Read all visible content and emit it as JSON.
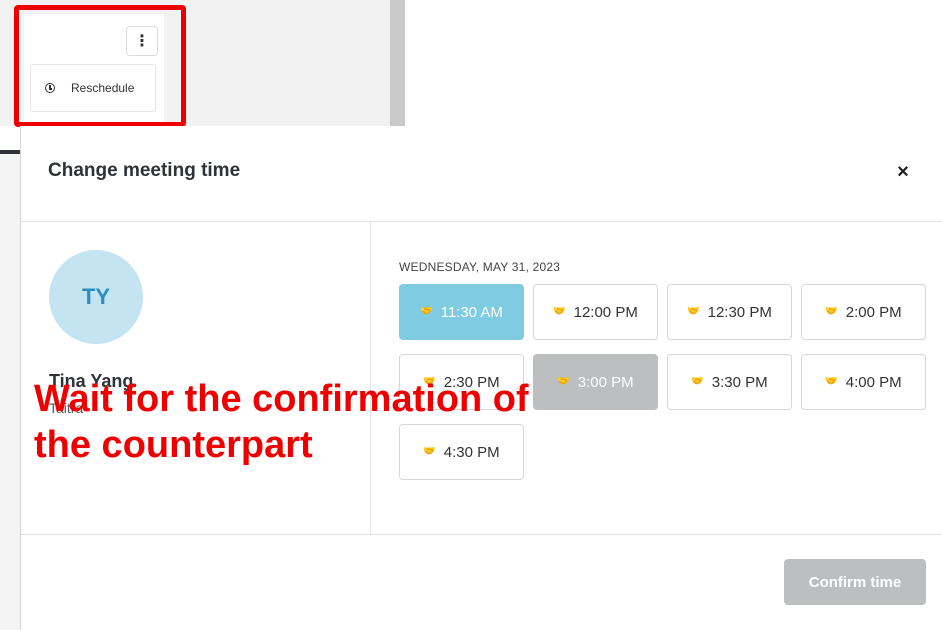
{
  "menu": {
    "more_icon": "⋮",
    "reschedule_label": "Reschedule"
  },
  "modal": {
    "title": "Change meeting time",
    "close_icon": "×",
    "contact": {
      "initials": "TY",
      "name": "Tina Yang",
      "organization": "Taitra"
    },
    "date_label": "WEDNESDAY, MAY 31, 2023",
    "slots": [
      {
        "time": "11:30 AM",
        "state": "selected"
      },
      {
        "time": "12:00 PM",
        "state": "available"
      },
      {
        "time": "12:30 PM",
        "state": "available"
      },
      {
        "time": "2:00 PM",
        "state": "available"
      },
      {
        "time": "2:30 PM",
        "state": "available"
      },
      {
        "time": "3:00 PM",
        "state": "disabled"
      },
      {
        "time": "3:30 PM",
        "state": "available"
      },
      {
        "time": "4:00 PM",
        "state": "available"
      },
      {
        "time": "4:30 PM",
        "state": "available"
      }
    ],
    "confirm_label": "Confirm time"
  },
  "annotation": {
    "line1": "Wait for the confirmation of",
    "line2": "the counterpart"
  },
  "colors": {
    "highlight": "#ee0000",
    "selected_slot": "#7fcbe2",
    "disabled_slot": "#bcbebf",
    "avatar_bg": "#c5e4f2",
    "avatar_text": "#2a8fc0"
  }
}
